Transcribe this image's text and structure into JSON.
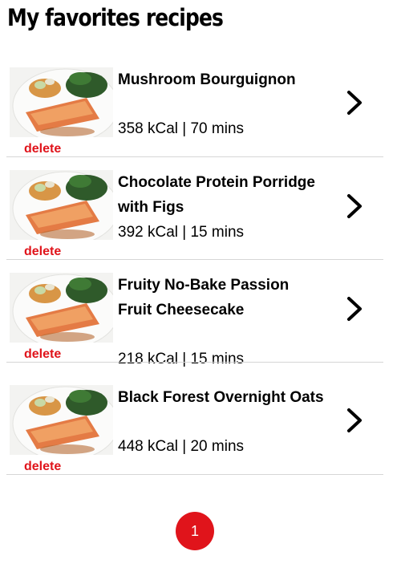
{
  "header": {
    "title": "My favorites recipes"
  },
  "recipes": [
    {
      "title": "Mushroom Bourguignon",
      "meta": "358 kCal | 70 mins",
      "delete_label": "delete",
      "thumb_icon": "salmon-plate-image"
    },
    {
      "title": "Chocolate Protein Porridge with Figs",
      "meta": "392 kCal | 15 mins",
      "delete_label": "delete",
      "thumb_icon": "salmon-plate-image"
    },
    {
      "title": "Fruity No-Bake Passion Fruit Cheesecake",
      "meta": "218 kCal | 15 mins",
      "delete_label": "delete",
      "thumb_icon": "salmon-plate-image"
    },
    {
      "title": "Black Forest Overnight Oats",
      "meta": "448 kCal | 20 mins",
      "delete_label": "delete",
      "thumb_icon": "salmon-plate-image"
    }
  ],
  "pagination": {
    "current_page": "1"
  },
  "colors": {
    "accent": "#e0141b",
    "divider": "#d6d6d6"
  }
}
